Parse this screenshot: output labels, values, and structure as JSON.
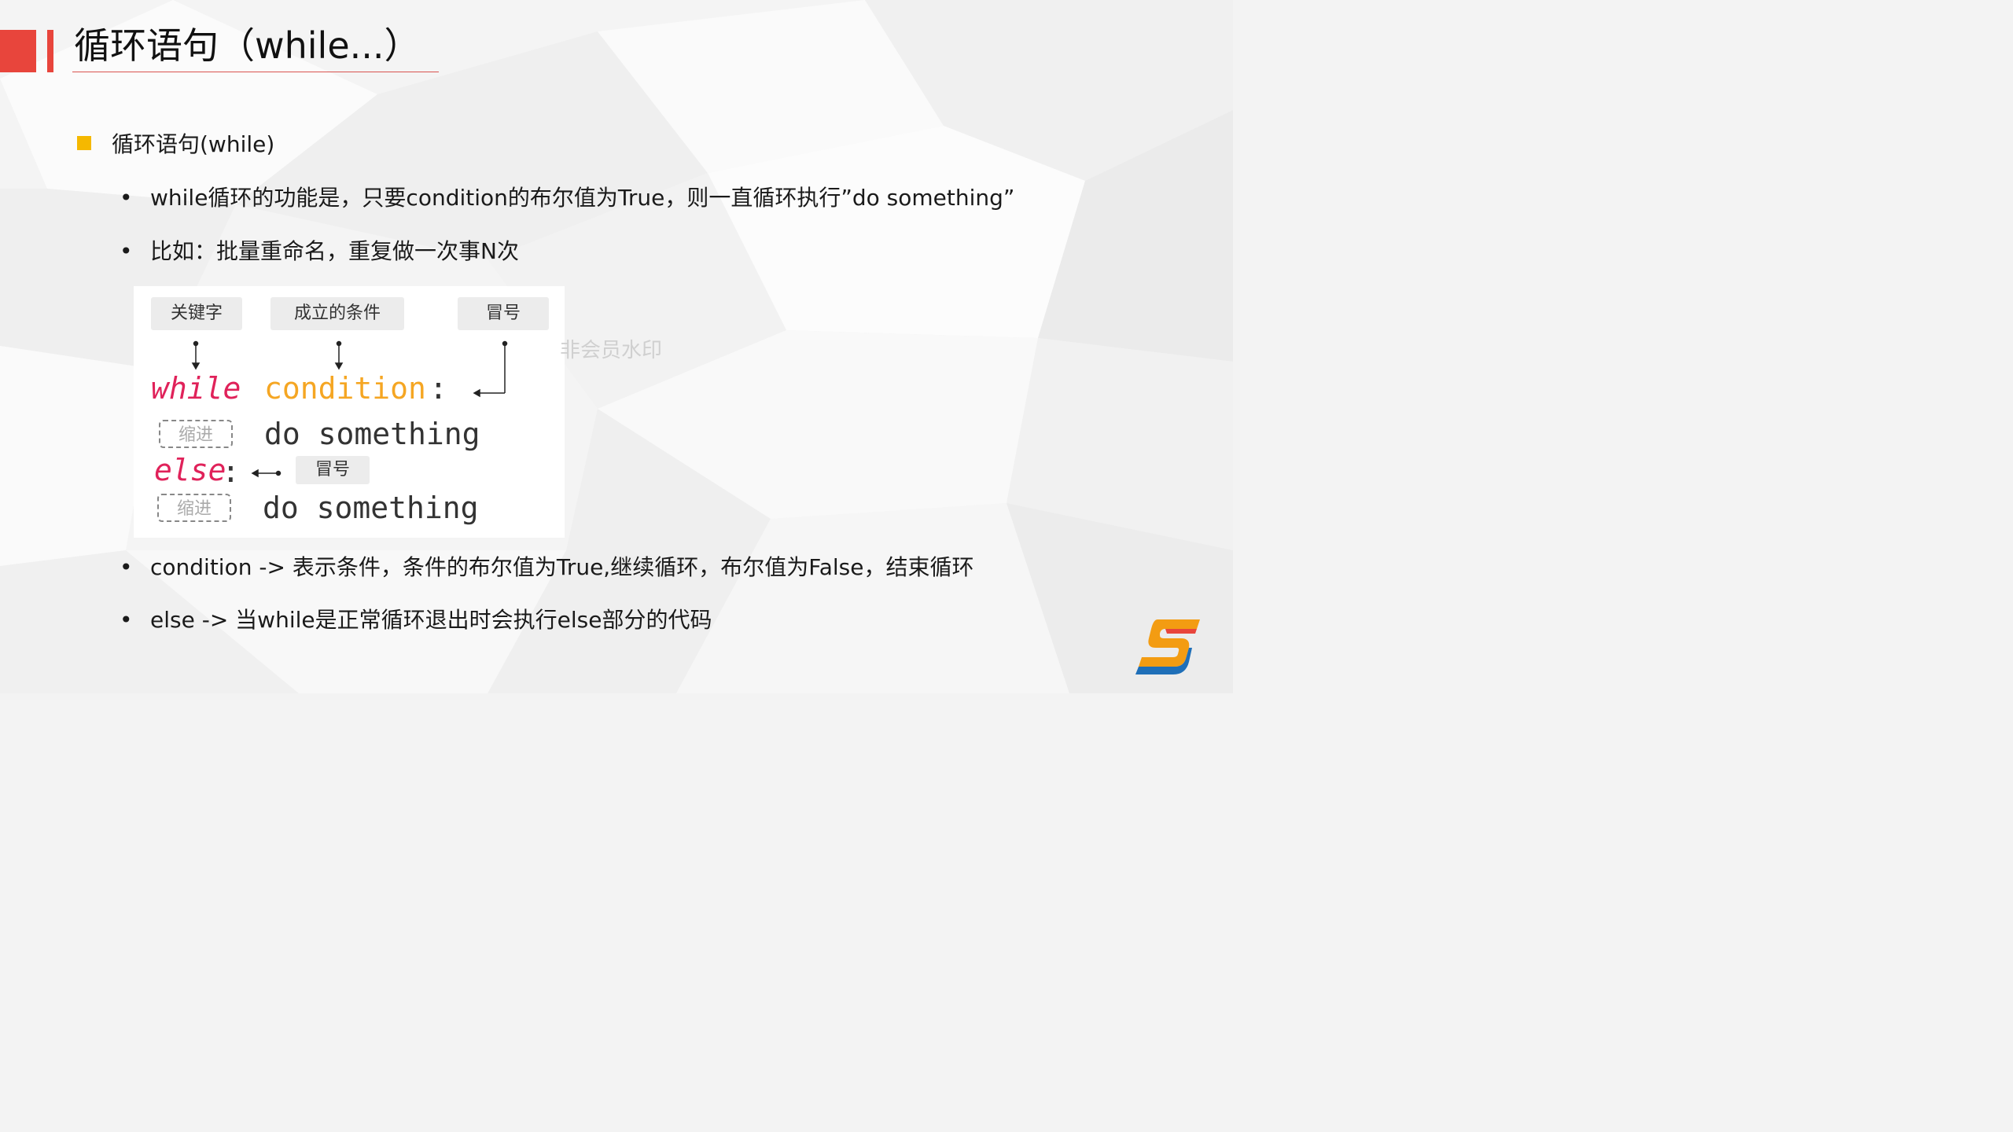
{
  "slide": {
    "title": "循环语句（while...）",
    "section": "循环语句(while)",
    "bullets": [
      "while循环的功能是，只要condition的布尔值为True，则一直循环执行”do something”",
      "比如：批量重命名，重复做一次事N次",
      "condition -> 表示条件，条件的布尔值为True,继续循环，布尔值为False，结束循环",
      "else -> 当while是正常循环退出时会执行else部分的代码"
    ],
    "bullet_marker": "•",
    "watermark": "非会员水印"
  },
  "diagram": {
    "tag_keyword": "关键字",
    "tag_condition": "成立的条件",
    "tag_colon": "冒号",
    "tag_colon_else": "冒号",
    "kw_while": "while",
    "condition": "condition",
    "colon": ":",
    "indent_label": "缩进",
    "do_something": "do something",
    "kw_else": "else",
    "else_colon": ":"
  },
  "colors": {
    "accent": "#e8453c",
    "section_marker": "#f5b800",
    "keyword": "#e0225a",
    "condition": "#f5a623"
  },
  "icons": {
    "logo": "brand-logo-icon"
  }
}
